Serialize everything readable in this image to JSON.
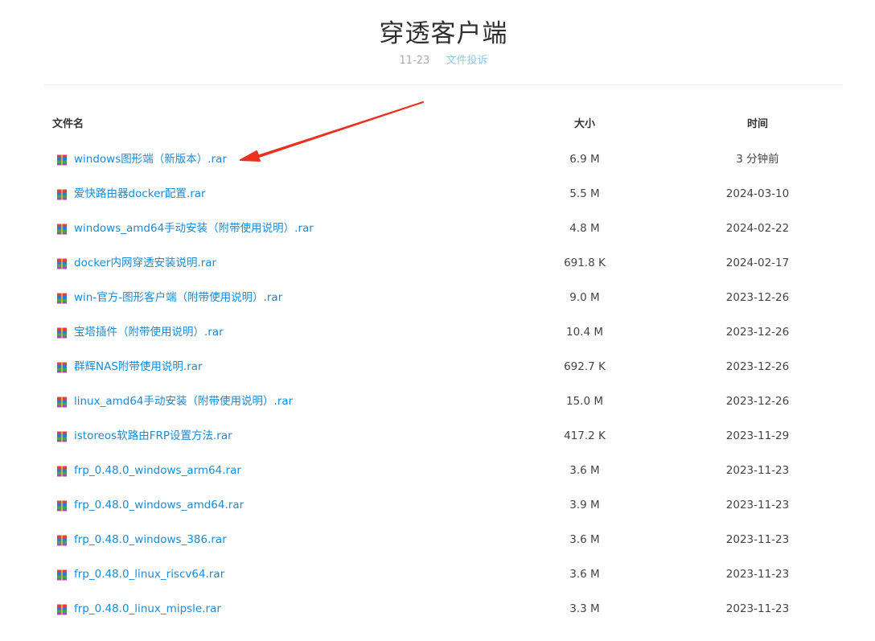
{
  "header": {
    "title": "穿透客户端",
    "date": "11-23",
    "report_link": "文件投诉"
  },
  "table": {
    "columns": {
      "name": "文件名",
      "size": "大小",
      "time": "时间"
    },
    "rows": [
      {
        "name": "windows图形端（新版本）.rar",
        "size": "6.9 M",
        "time": "3 分钟前"
      },
      {
        "name": "爱快路由器docker配置.rar",
        "size": "5.5 M",
        "time": "2024-03-10"
      },
      {
        "name": "windows_amd64手动安装（附带使用说明）.rar",
        "size": "4.8 M",
        "time": "2024-02-22"
      },
      {
        "name": "docker内网穿透安装说明.rar",
        "size": "691.8 K",
        "time": "2024-02-17"
      },
      {
        "name": "win-官方-图形客户端（附带使用说明）.rar",
        "size": "9.0 M",
        "time": "2023-12-26"
      },
      {
        "name": "宝塔插件（附带使用说明）.rar",
        "size": "10.4 M",
        "time": "2023-12-26"
      },
      {
        "name": "群辉NAS附带使用说明.rar",
        "size": "692.7 K",
        "time": "2023-12-26"
      },
      {
        "name": "linux_amd64手动安装（附带使用说明）.rar",
        "size": "15.0 M",
        "time": "2023-12-26"
      },
      {
        "name": "istoreos软路由FRP设置方法.rar",
        "size": "417.2 K",
        "time": "2023-11-29"
      },
      {
        "name": "frp_0.48.0_windows_arm64.rar",
        "size": "3.6 M",
        "time": "2023-11-23"
      },
      {
        "name": "frp_0.48.0_windows_amd64.rar",
        "size": "3.9 M",
        "time": "2023-11-23"
      },
      {
        "name": "frp_0.48.0_windows_386.rar",
        "size": "3.6 M",
        "time": "2023-11-23"
      },
      {
        "name": "frp_0.48.0_linux_riscv64.rar",
        "size": "3.6 M",
        "time": "2023-11-23"
      },
      {
        "name": "frp_0.48.0_linux_mipsle.rar",
        "size": "3.3 M",
        "time": "2023-11-23"
      }
    ]
  },
  "colors": {
    "link": "#1a8bd6",
    "arrow": "#e8321e",
    "divider": "#e8e8e8"
  },
  "icons": {
    "file": "rar-archive-icon",
    "annotation": "red-arrow-annotation"
  }
}
